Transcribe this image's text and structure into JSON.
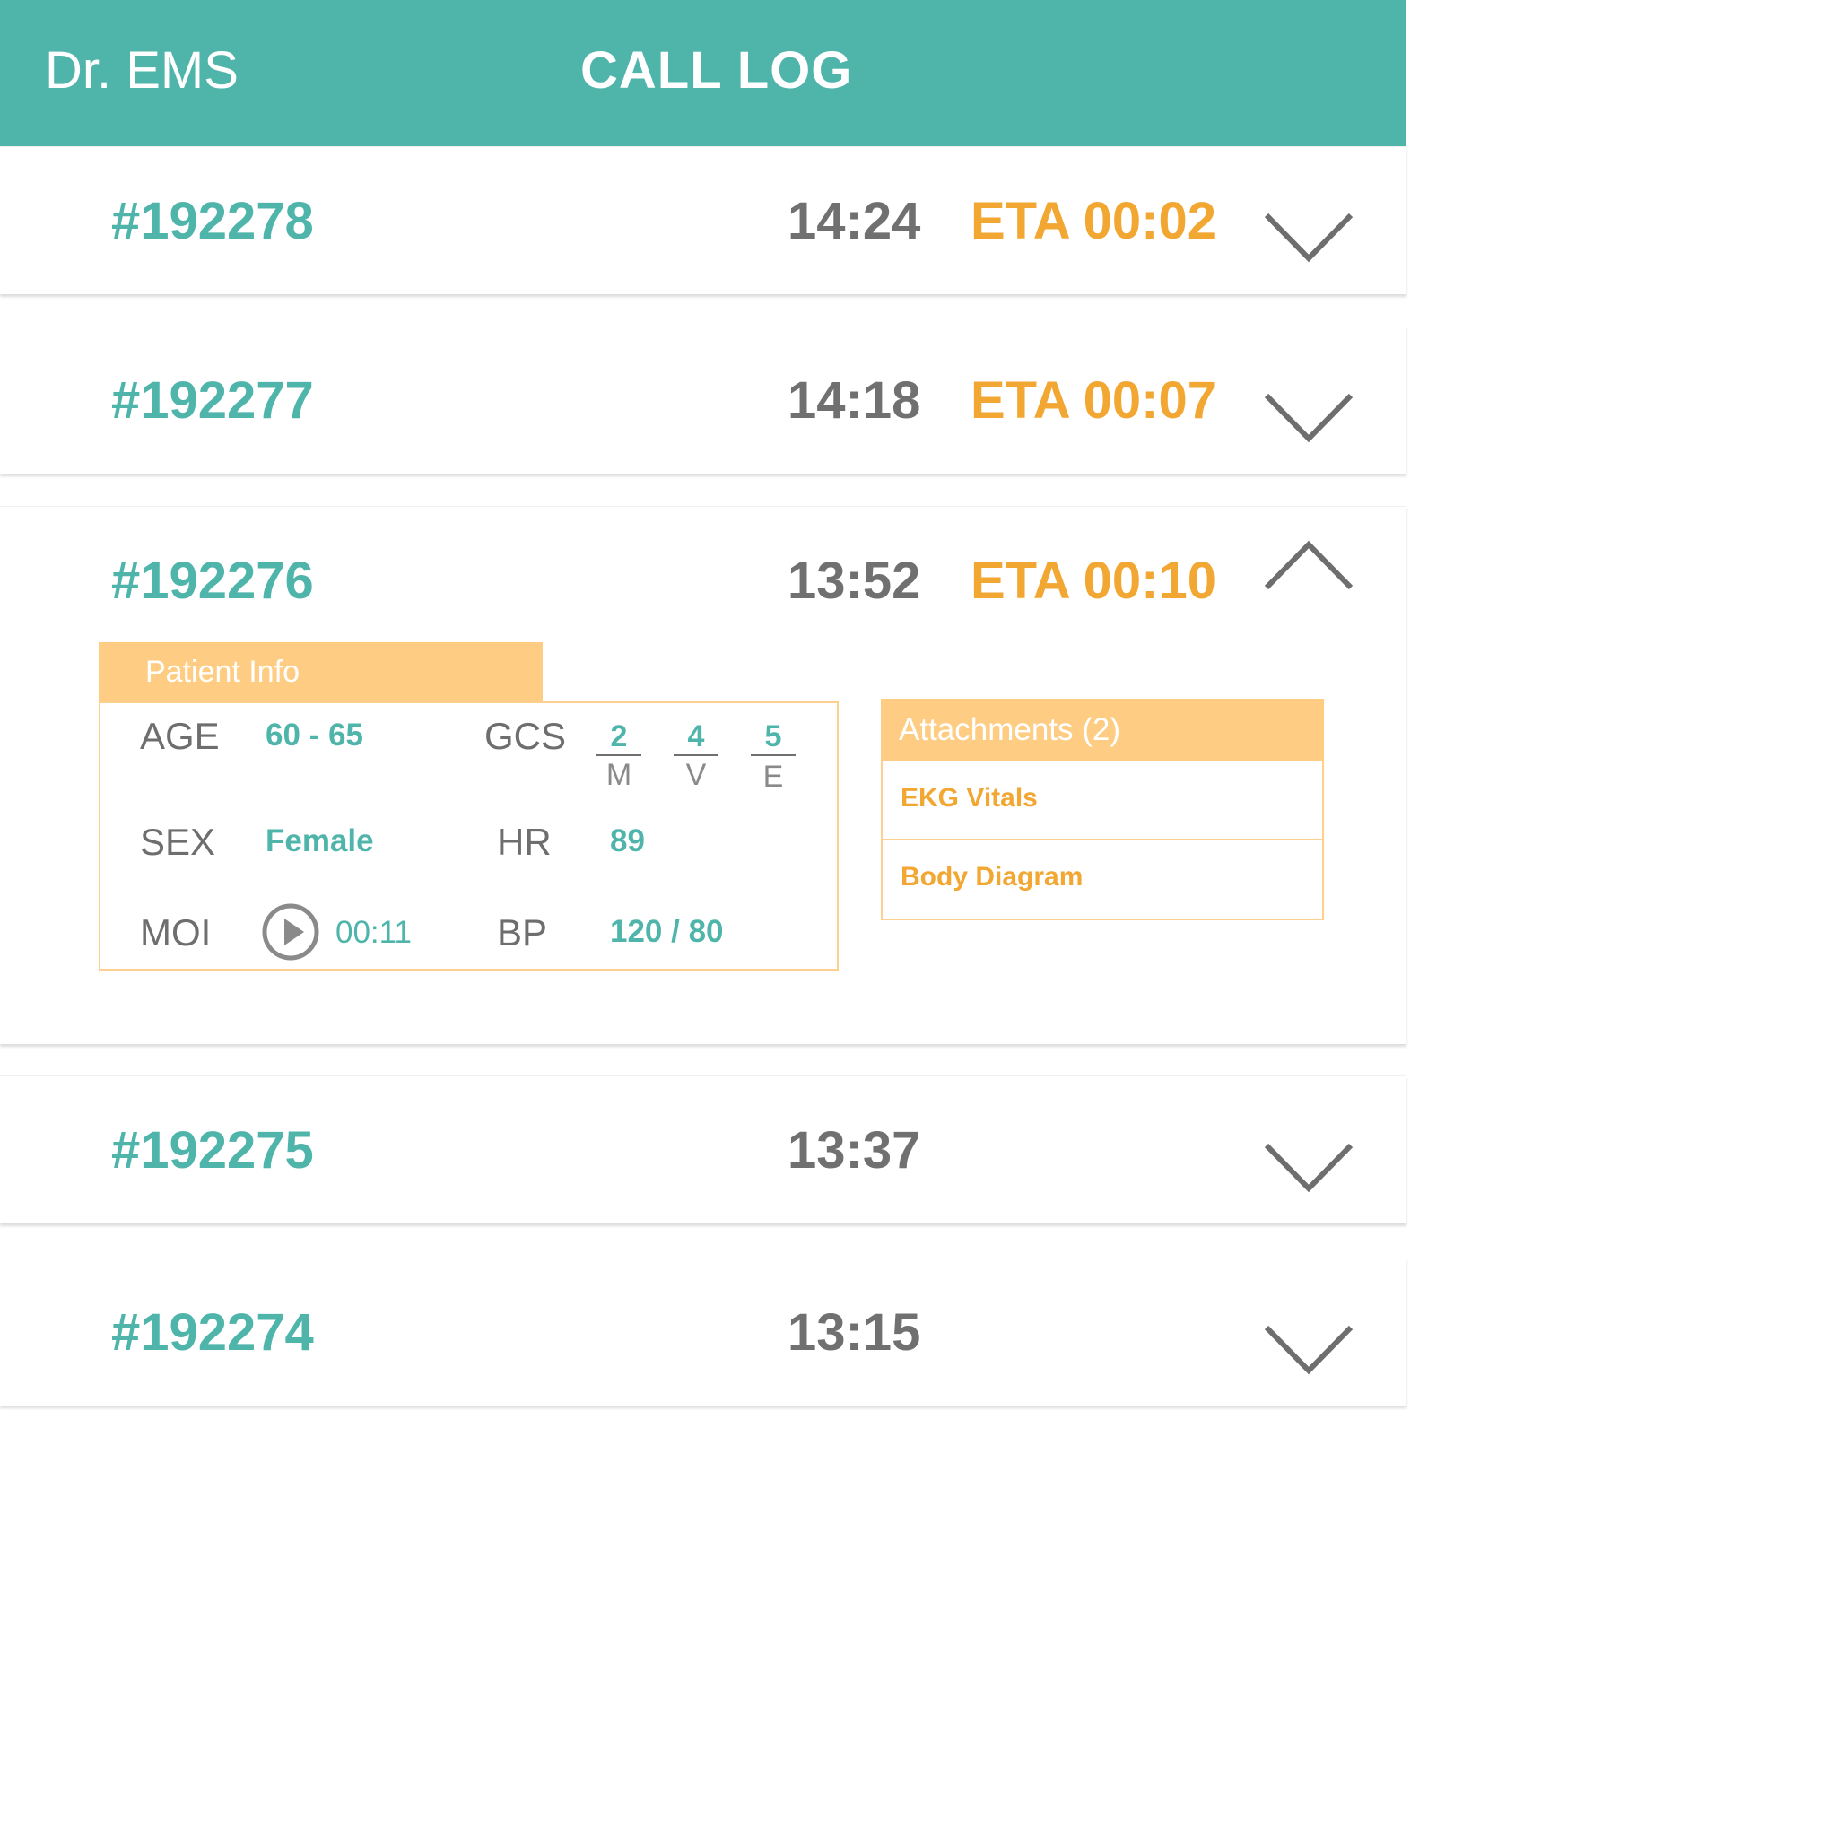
{
  "header": {
    "app_title": "Dr. EMS",
    "screen_title": "CALL LOG"
  },
  "colors": {
    "primary_teal": "#4fb5ab",
    "eta_orange": "#f2a733",
    "panel_header": "#fecd83",
    "text_gray": "#707070"
  },
  "calls": [
    {
      "id": "#192278",
      "time": "14:24",
      "eta": "ETA 00:02",
      "icon": "chevron-down-icon"
    },
    {
      "id": "#192277",
      "time": "14:18",
      "eta": "ETA 00:07",
      "icon": "chevron-down-icon"
    },
    {
      "id": "#192276",
      "time": "13:52",
      "eta": "ETA 00:10",
      "icon": "chevron-up-icon",
      "expanded": true,
      "patient_info": {
        "title": "Patient Info",
        "age_label": "AGE",
        "age_value": "60 - 65",
        "sex_label": "SEX",
        "sex_value": "Female",
        "moi_label": "MOI",
        "moi_duration": "00:11",
        "gcs_label": "GCS",
        "gcs": [
          {
            "score": "2",
            "letter": "M"
          },
          {
            "score": "4",
            "letter": "V"
          },
          {
            "score": "5",
            "letter": "E"
          }
        ],
        "hr_label": "HR",
        "hr_value": "89",
        "bp_label": "BP",
        "bp_value": "120 / 80"
      },
      "attachments": {
        "title": "Attachments (2)",
        "items": [
          "EKG Vitals",
          "Body Diagram"
        ]
      }
    },
    {
      "id": "#192275",
      "time": "13:37",
      "eta": "",
      "icon": "chevron-down-icon"
    },
    {
      "id": "#192274",
      "time": "13:15",
      "eta": "",
      "icon": "chevron-down-icon"
    }
  ]
}
